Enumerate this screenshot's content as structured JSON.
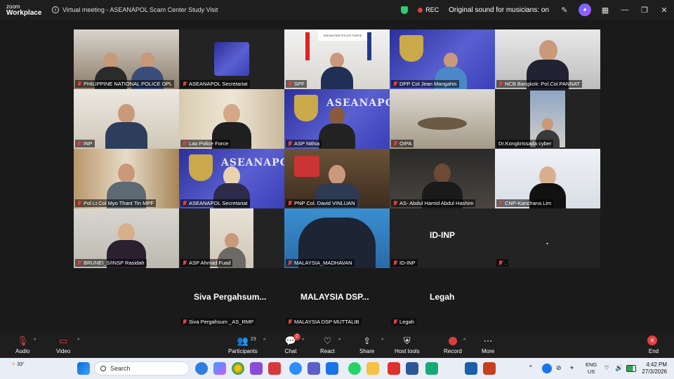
{
  "app": {
    "logo_line1": "zoom",
    "logo_line2": "Workplace",
    "title": "Virtual meeting - ASEANAPOL Scam Center Study Visit",
    "rec_label": "REC",
    "original_sound": "Original sound for musicians: on"
  },
  "tiles": [
    {
      "name": "PHILIPPINE NATIONAL POLICE DPL"
    },
    {
      "name": "ASEANAPOL Secretariat"
    },
    {
      "name": "SPF"
    },
    {
      "name": "DPP Col Jean Mangahis"
    },
    {
      "name": "NCB Bangkok: Pol.Col.PANNAT"
    },
    {
      "name": "INP"
    },
    {
      "name": "Lao Police Force"
    },
    {
      "name": "ASP Nithia"
    },
    {
      "name": "OIPA"
    },
    {
      "name": "Dr.Kongkrissada cyber"
    },
    {
      "name": "Pol Lt Col Myo Thant Tin MPF"
    },
    {
      "name": "ASEANAPOL Secretariat"
    },
    {
      "name": "PNP Col. David VINLUAN"
    },
    {
      "name": "AS- Abdul Hamid Abdul Hashim"
    },
    {
      "name": "CNP-Kanchana Lim"
    },
    {
      "name": "BRUNEI_S/INSP Rasidah"
    },
    {
      "name": "ASP Ahmad Fuad"
    },
    {
      "name": "MALAYSIA_MADHAVAN"
    },
    {
      "name": "ID-INP",
      "center": "ID-INP"
    },
    {
      "name": ".",
      "center": "."
    }
  ],
  "bottom_row": [
    {
      "display": "Siva  Pergahsum...",
      "label": "Siva Pergahsum _AS_RMP"
    },
    {
      "display": "MALAYSIA  DSP...",
      "label": "MALAYSIA DSP MUTTALIB"
    },
    {
      "display": "Legah",
      "label": "Legah"
    }
  ],
  "aseanapol_word": "ASEANAPOL",
  "spf_sign": "SINGAPORE POLICE FORCE",
  "toolbar": {
    "audio": "Audio",
    "video": "Video",
    "participants": "Participants",
    "participants_count": "23",
    "chat": "Chat",
    "chat_badge": "2",
    "react": "React",
    "share": "Share",
    "host_tools": "Host tools",
    "record": "Record",
    "more": "More",
    "end": "End"
  },
  "taskbar": {
    "weather": "33°",
    "search_placeholder": "Search",
    "lang_line1": "ENG",
    "lang_line2": "US",
    "time": "4:42 PM",
    "date": "27/3/2026"
  },
  "colors": {
    "active_speaker": "#3ed67a",
    "rec": "#e03e3e",
    "aseanapol_blue": "#3a3fb8"
  }
}
